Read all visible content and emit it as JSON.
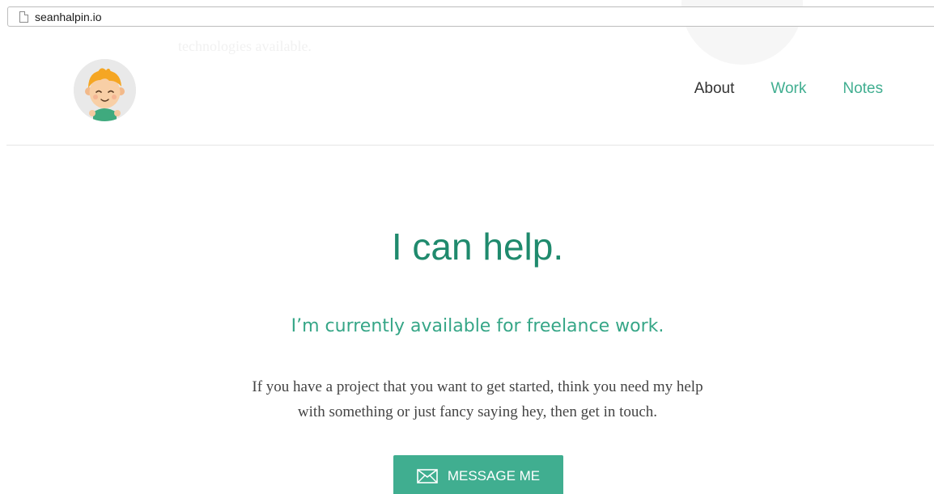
{
  "browser": {
    "url": "seanhalpin.io"
  },
  "background": {
    "scrolled_text": "technologies available."
  },
  "nav": {
    "items": [
      {
        "label": "About"
      },
      {
        "label": "Work"
      },
      {
        "label": "Notes"
      }
    ],
    "active": "About"
  },
  "hero": {
    "title": "I can help.",
    "subtitle": "I’m currently available for freelance work.",
    "body_line1": "If you have a project that you want to get started, think you need my help",
    "body_line2": "with something or just fancy saying hey, then get in touch.",
    "cta_label": "MESSAGE ME"
  },
  "colors": {
    "accent": "#40ae90",
    "title": "#1f8a6d",
    "text": "#444444"
  },
  "icons": {
    "avatar": "cartoon-boy-avatar",
    "cta": "envelope-icon",
    "url": "page-icon"
  }
}
